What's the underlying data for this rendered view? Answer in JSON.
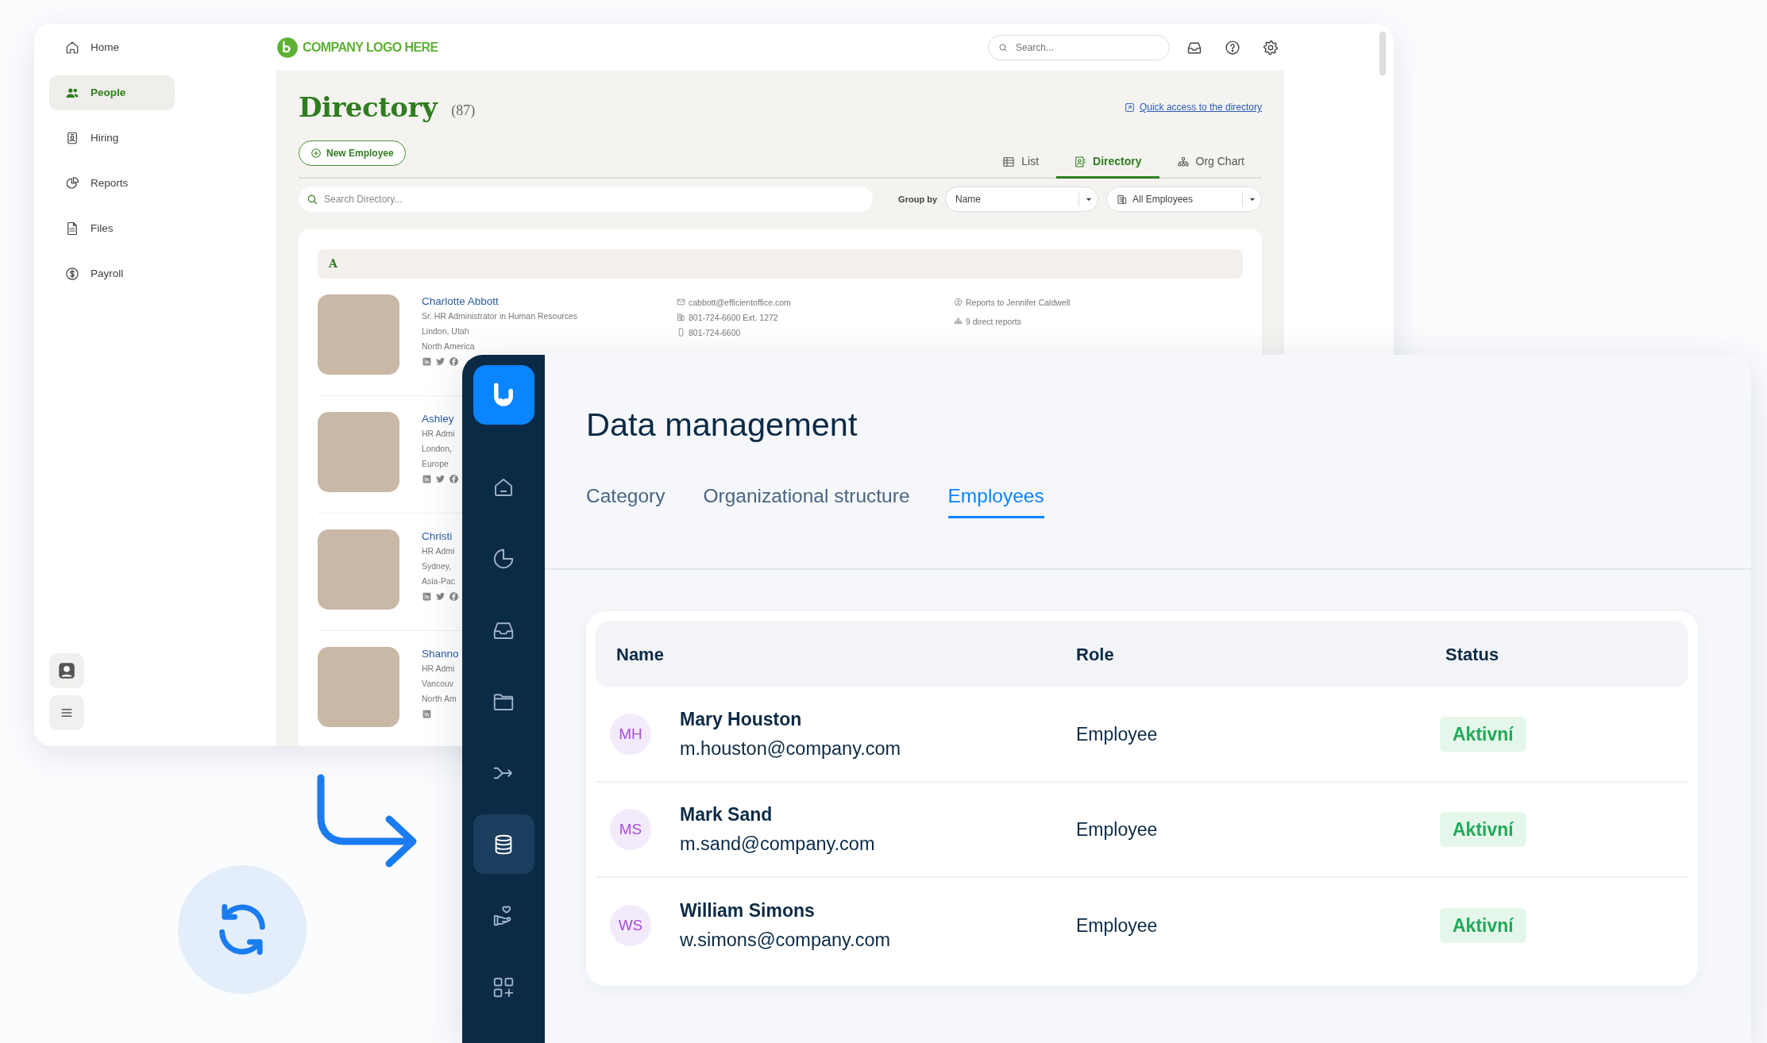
{
  "back_window": {
    "sidebar": [
      {
        "kind": "home",
        "label": "Home",
        "selected": false
      },
      {
        "kind": "people",
        "label": "People",
        "selected": true
      },
      {
        "kind": "hiring",
        "label": "Hiring",
        "selected": false
      },
      {
        "kind": "reports",
        "label": "Reports",
        "selected": false
      },
      {
        "kind": "files",
        "label": "Files",
        "selected": false
      },
      {
        "kind": "payroll",
        "label": "Payroll",
        "selected": false
      }
    ],
    "logo": "COMPANY LOGO HERE",
    "search": {
      "placeholder": "Search..."
    },
    "title": "Directory",
    "count": "(87)",
    "new_button": "New Employee",
    "quick_link": "Quick access to the directory",
    "tabs": [
      {
        "kind": "list",
        "label": "List",
        "selected": false
      },
      {
        "kind": "directory",
        "label": "Directory",
        "selected": true
      },
      {
        "kind": "org",
        "label": "Org Chart",
        "selected": false
      }
    ],
    "directory_search": {
      "placeholder": "Search Directory..."
    },
    "group_by": {
      "label": "Group by",
      "value": "Name"
    },
    "filter": {
      "value": "All Employees"
    },
    "group": "A",
    "employees": [
      {
        "name": "Charlotte Abbott",
        "details": [
          "Sr. HR Administrator in Human Resources",
          "Lindon, Utah",
          "North America"
        ],
        "socials": [
          {
            "kind": "linkedin"
          },
          {
            "kind": "twitter"
          },
          {
            "kind": "facebook"
          }
        ],
        "email": "cabbott@efficientoffice.com",
        "phone": "801-724-6600 Ext. 1272",
        "mobile": "801-724-6600",
        "reports_to": "Reports to Jennifer Caldwell",
        "direct_reports": "9 direct reports"
      },
      {
        "name": "Ashley",
        "details": [
          "HR Admi",
          "London,",
          "Europe"
        ],
        "socials": [
          {
            "kind": "linkedin"
          },
          {
            "kind": "twitter"
          },
          {
            "kind": "facebook"
          }
        ]
      },
      {
        "name": "Christi",
        "details": [
          "HR Admi",
          "Sydney,",
          "Asia-Pac"
        ],
        "socials": [
          {
            "kind": "linkedin"
          },
          {
            "kind": "twitter"
          },
          {
            "kind": "facebook"
          }
        ]
      },
      {
        "name": "Shanno",
        "details": [
          "HR Admi",
          "Vancouv",
          "North Am"
        ],
        "socials": [
          {
            "kind": "linkedin"
          }
        ]
      }
    ]
  },
  "front_window": {
    "nav": [
      {
        "kind": "home",
        "selected": false
      },
      {
        "kind": "chart",
        "selected": false
      },
      {
        "kind": "inbox",
        "selected": false
      },
      {
        "kind": "folder",
        "selected": false
      },
      {
        "kind": "shuffle",
        "selected": false
      },
      {
        "kind": "database",
        "selected": true
      },
      {
        "kind": "hand",
        "selected": false
      },
      {
        "kind": "apps",
        "selected": false
      }
    ],
    "title": "Data management",
    "tabs": [
      {
        "label": "Category",
        "selected": false
      },
      {
        "label": "Organizational structure",
        "selected": false
      },
      {
        "label": "Employees",
        "selected": true
      }
    ],
    "table": {
      "columns": [
        "Name",
        "Role",
        "Status"
      ],
      "rows": [
        {
          "initials": "MH",
          "name": "Mary Houston",
          "email": "m.houston@company.com",
          "role": "Employee",
          "status": "Aktivní"
        },
        {
          "initials": "MS",
          "name": "Mark Sand",
          "email": "m.sand@company.com",
          "role": "Employee",
          "status": "Aktivní"
        },
        {
          "initials": "WS",
          "name": "William Simons",
          "email": "w.simons@company.com",
          "role": "Employee",
          "status": "Aktivní"
        }
      ]
    }
  }
}
